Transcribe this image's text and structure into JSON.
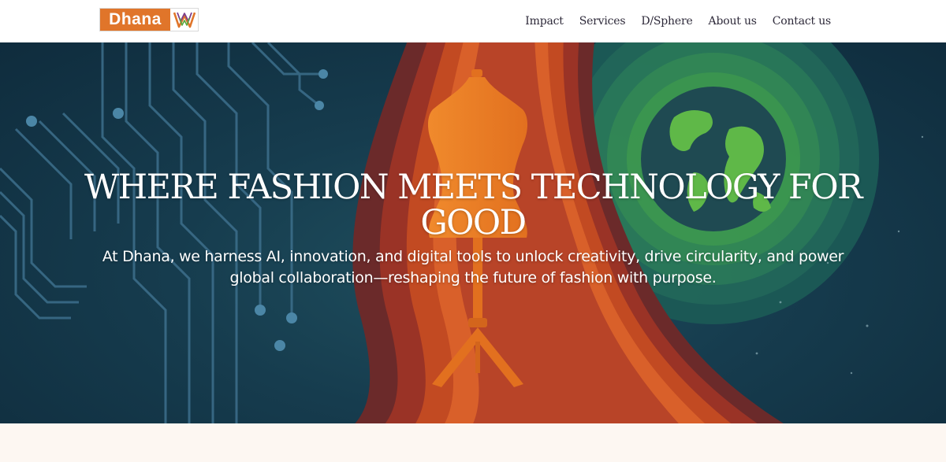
{
  "header": {
    "logo": {
      "word": "Dhana",
      "mark_icon": "dhana-w-monogram-icon"
    },
    "nav": [
      {
        "label": "Impact"
      },
      {
        "label": "Services"
      },
      {
        "label": "D/Sphere"
      },
      {
        "label": "About us"
      },
      {
        "label": "Contact us"
      }
    ]
  },
  "hero": {
    "title": "WHERE FASHION MEETS TECHNOLOGY FOR GOOD",
    "subtitle": "At Dhana, we harness AI, innovation, and digital tools to unlock creativity, drive circularity, and power global collaboration—reshaping the future of fashion with purpose.",
    "illustration": [
      "circuit-lines",
      "dress-form-mannequin",
      "orange-waves",
      "globe-with-rings"
    ]
  },
  "colors": {
    "brand_orange": "#e0752a",
    "hero_dark": "#163c4e",
    "nav_text": "#2e2a3a",
    "next_section_bg": "#fdf7f2"
  }
}
